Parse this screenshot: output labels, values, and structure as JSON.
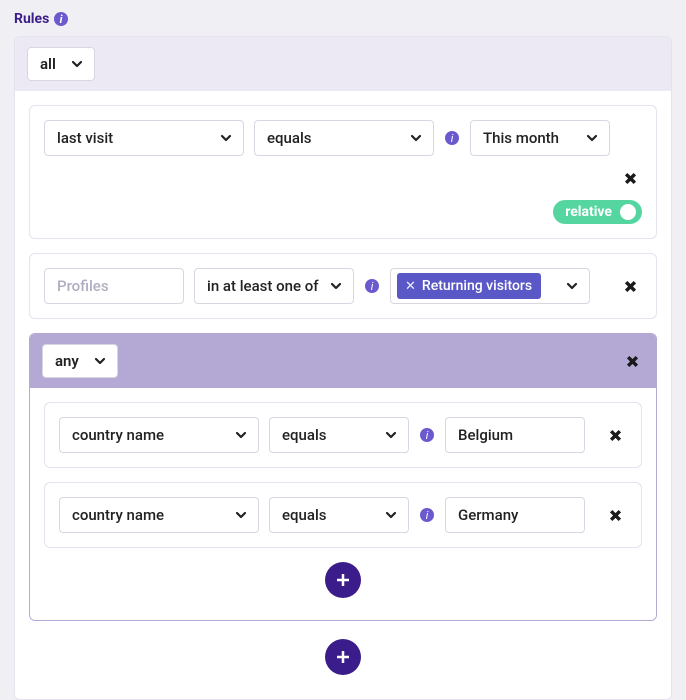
{
  "header": {
    "title": "Rules"
  },
  "root": {
    "combinator": "all"
  },
  "rule1": {
    "field": "last visit",
    "operator": "equals",
    "value": "This month",
    "toggle_label": "relative"
  },
  "rule2": {
    "field_placeholder": "Profiles",
    "operator": "in at least one of",
    "chip_value": "Returning visitors"
  },
  "subgroup": {
    "combinator": "any",
    "rows": [
      {
        "field": "country name",
        "operator": "equals",
        "value": "Belgium"
      },
      {
        "field": "country name",
        "operator": "equals",
        "value": "Germany"
      }
    ]
  }
}
